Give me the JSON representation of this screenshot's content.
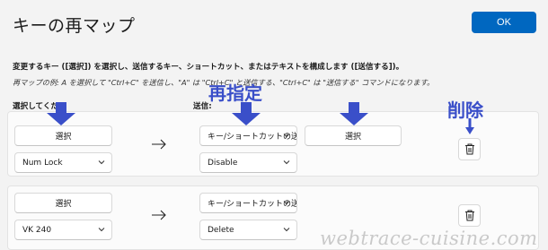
{
  "window": {
    "title": "キーの再マップ",
    "ok_label": "OK"
  },
  "instructions": {
    "main": "変更するキー ([選択]) を選択し、送信するキー、ショートカット、またはテキストを構成します ([送信する])。",
    "example": "再マップの例: A を選択して \"Ctrl+C\" を送信し、\"A\" は \"Ctrl+C\" と送信する、\"Ctrl+C\" は \"送信する\" コマンドになります。"
  },
  "columns": {
    "select_header": "選択してくだ",
    "send_header": "送信:"
  },
  "rows": [
    {
      "select_label": "選択",
      "key_value": "Num Lock",
      "type_value": "キー/ショートカットの送",
      "action_value": "Disable",
      "send_select_label": "選択"
    },
    {
      "select_label": "選択",
      "key_value": "VK 240",
      "type_value": "キー/ショートカットの送",
      "action_value": "Delete"
    }
  ],
  "annotations": {
    "respecify": "再指定",
    "delete": "削除",
    "annotation_color": "#3a4fc9"
  },
  "watermark": "webtrace-cuisine.com",
  "colors": {
    "accent": "#0067c0",
    "background": "#f3f3f3"
  },
  "icons": {
    "arrow": "arrow-right-icon",
    "trash": "trash-icon",
    "dropdown": "chevron-down-icon"
  }
}
